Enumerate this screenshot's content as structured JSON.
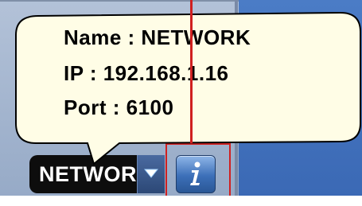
{
  "tooltip": {
    "name_line": "Name : NETWORK",
    "ip_line": "IP : 192.168.1.16",
    "port_line": "Port : 6100"
  },
  "device_selector": {
    "selected_value": "NETWORK",
    "dropdown_icon": "triangle-down-icon"
  },
  "info_button": {
    "icon": "info-icon"
  },
  "colors": {
    "tooltip_fill": "#fffde6",
    "highlight": "#d02020",
    "panel_blue": "#3a68b4"
  }
}
